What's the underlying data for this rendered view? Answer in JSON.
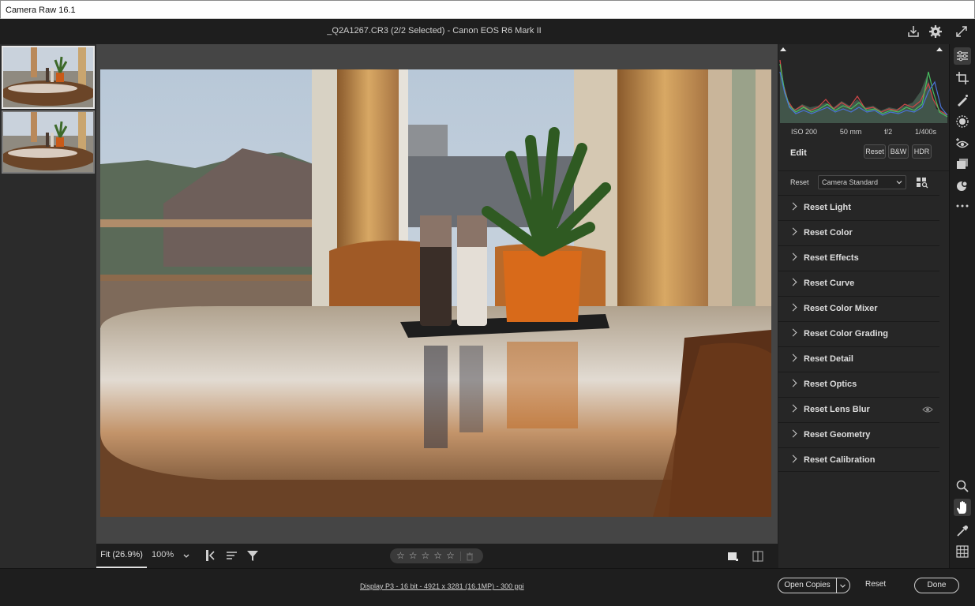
{
  "window": {
    "title": "Camera Raw 16.1"
  },
  "header": {
    "file_info": "_Q2A1267.CR3 (2/2 Selected)  -  Canon EOS R6 Mark II"
  },
  "filmstrip": {
    "count": 2,
    "selected_index": 0
  },
  "histogram": {
    "exif": {
      "iso": "ISO 200",
      "focal": "50 mm",
      "aperture": "f/2",
      "shutter": "1/400s"
    }
  },
  "edit": {
    "title": "Edit",
    "reset_label": "Reset",
    "bw_label": "B&W",
    "hdr_label": "HDR",
    "profile_reset_label": "Reset",
    "profile_value": "Camera Standard"
  },
  "sections": [
    {
      "label": "Reset Light"
    },
    {
      "label": "Reset Color"
    },
    {
      "label": "Reset Effects"
    },
    {
      "label": "Reset Curve"
    },
    {
      "label": "Reset Color Mixer"
    },
    {
      "label": "Reset Color Grading"
    },
    {
      "label": "Reset Detail"
    },
    {
      "label": "Reset Optics"
    },
    {
      "label": "Reset Lens Blur"
    },
    {
      "label": "Reset Geometry"
    },
    {
      "label": "Reset Calibration"
    }
  ],
  "view": {
    "fit_label": "Fit (26.9%)",
    "zoom_label": "100%"
  },
  "rating": {
    "stars": 0,
    "max": 5
  },
  "footer": {
    "info": "Display P3 - 16 bit - 4921 x 3281 (16.1MP) - 300 ppi",
    "open_copies_label": "Open Copies",
    "reset_label": "Reset",
    "done_label": "Done"
  },
  "icons": {
    "rail": [
      "edit-sliders-icon",
      "crop-icon",
      "healing-icon",
      "masking-icon",
      "red-eye-icon",
      "snapshots-icon",
      "presets-icon",
      "more-icon",
      "zoom-icon",
      "hand-icon",
      "sampler-icon",
      "grid-icon"
    ],
    "top": [
      "save-icon",
      "settings-gear-icon",
      "fullscreen-icon"
    ]
  }
}
